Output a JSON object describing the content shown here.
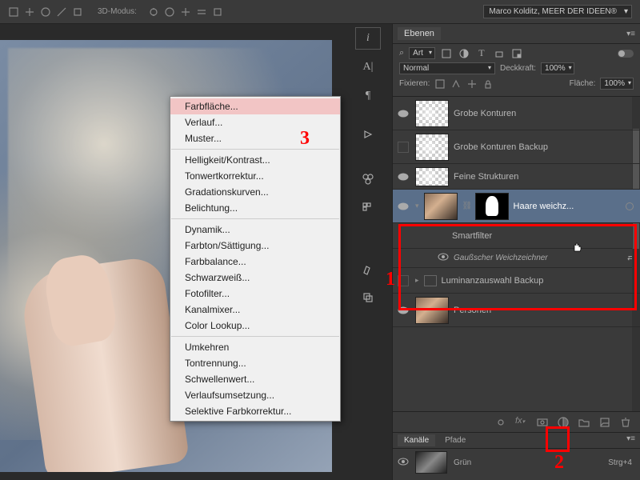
{
  "topbar": {
    "label3d": "3D-Modus:",
    "user_dropdown": "Marco Kolditz, MEER DER IDEEN®"
  },
  "context_menu": {
    "items": [
      {
        "label": "Farbfläche...",
        "hover": true
      },
      {
        "label": "Verlauf..."
      },
      {
        "label": "Muster..."
      },
      {
        "sep": true
      },
      {
        "label": "Helligkeit/Kontrast..."
      },
      {
        "label": "Tonwertkorrektur..."
      },
      {
        "label": "Gradationskurven..."
      },
      {
        "label": "Belichtung..."
      },
      {
        "sep": true
      },
      {
        "label": "Dynamik..."
      },
      {
        "label": "Farbton/Sättigung..."
      },
      {
        "label": "Farbbalance..."
      },
      {
        "label": "Schwarzweiß..."
      },
      {
        "label": "Fotofilter..."
      },
      {
        "label": "Kanalmixer..."
      },
      {
        "label": "Color Lookup..."
      },
      {
        "sep": true
      },
      {
        "label": "Umkehren"
      },
      {
        "label": "Tontrennung..."
      },
      {
        "label": "Schwellenwert..."
      },
      {
        "label": "Verlaufsumsetzung..."
      },
      {
        "label": "Selektive Farbkorrektur..."
      }
    ]
  },
  "layers_panel": {
    "tab": "Ebenen",
    "kind_filter": "Art",
    "blend_mode": "Normal",
    "opacity_label": "Deckkraft:",
    "opacity_value": "100%",
    "lock_label": "Fixieren:",
    "fill_label": "Fläche:",
    "fill_value": "100%",
    "layers": [
      {
        "name": "Grobe Konturen",
        "visible": true
      },
      {
        "name": "Grobe Konturen Backup",
        "visible": false
      },
      {
        "name": "Feine Strukturen",
        "visible": true
      },
      {
        "name": "Haare weichz...",
        "visible": true,
        "selected": true,
        "smart": true
      },
      {
        "name": "Smartfilter",
        "sub": true
      },
      {
        "name": "Gaußscher Weichzeichner",
        "sub2": true
      },
      {
        "name": "Luminanzauswahl Backup",
        "visible": false
      },
      {
        "name": "Personen",
        "visible": true
      }
    ]
  },
  "channels_panel": {
    "tabs": [
      "Kanäle",
      "Pfade"
    ],
    "active_tab": 0,
    "channel_name": "Grün",
    "channel_shortcut": "Strg+4"
  },
  "annotations": {
    "n1": "1",
    "n2": "2",
    "n3": "3"
  }
}
